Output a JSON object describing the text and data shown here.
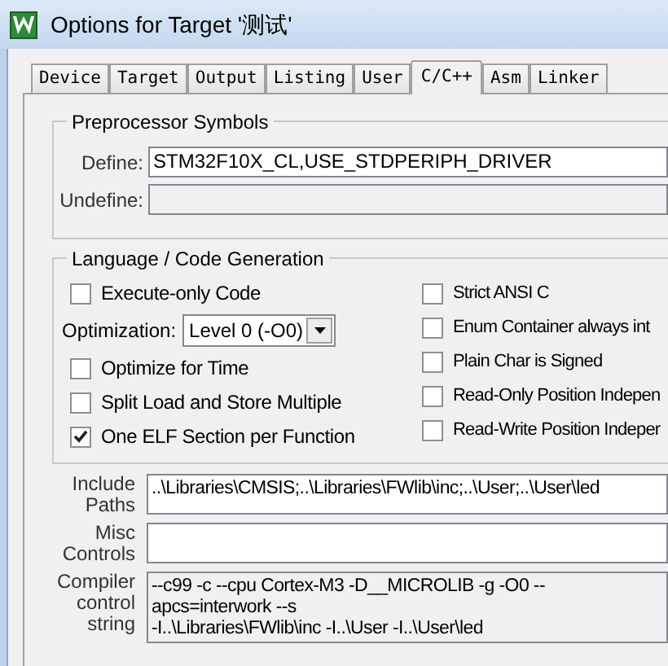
{
  "window": {
    "title": "Options for Target '测试'"
  },
  "tabs": [
    {
      "label": "Device",
      "selected": false
    },
    {
      "label": "Target",
      "selected": false
    },
    {
      "label": "Output",
      "selected": false
    },
    {
      "label": "Listing",
      "selected": false
    },
    {
      "label": "User",
      "selected": false
    },
    {
      "label": "C/C++",
      "selected": true
    },
    {
      "label": "Asm",
      "selected": false
    },
    {
      "label": "Linker",
      "selected": false
    }
  ],
  "preprocessor": {
    "title": "Preprocessor Symbols",
    "fields": [
      {
        "label": "Define:",
        "value": "STM32F10X_CL,USE_STDPERIPH_DRIVER",
        "disabled": false
      },
      {
        "label": "Undefine:",
        "disabled": true
      }
    ]
  },
  "language": {
    "title": "Language / Code Generation",
    "left": [
      {
        "kind": "checkbox",
        "label": "Execute-only Code",
        "checked": false
      },
      {
        "kind": "dropdown",
        "label": "Optimization:",
        "value": "Level 0 (-O0)"
      },
      {
        "kind": "checkbox",
        "label": "Optimize for Time",
        "checked": false
      },
      {
        "kind": "checkbox",
        "label": "Split Load and Store Multiple",
        "checked": false
      },
      {
        "kind": "checkbox",
        "label": "One ELF Section per Function",
        "checked": true
      }
    ],
    "right": [
      {
        "kind": "checkbox",
        "label": "Strict ANSI C",
        "checked": false
      },
      {
        "kind": "checkbox",
        "label": "Enum Container always int",
        "checked": false
      },
      {
        "kind": "checkbox",
        "label": "Plain Char is Signed",
        "checked": false
      },
      {
        "kind": "checkbox",
        "label": "Read-Only Position Indepen",
        "checked": false
      },
      {
        "kind": "checkbox",
        "label": "Read-Write Position Indeper",
        "checked": false
      }
    ]
  },
  "options": [
    {
      "label_lines": [
        "Include",
        "Paths"
      ],
      "lines": [
        "..\\Libraries\\CMSIS;..\\Libraries\\FWlib\\inc;..\\User;..\\User\\led"
      ],
      "disabled": false
    },
    {
      "label_lines": [
        "Misc",
        "Controls"
      ],
      "disabled": false
    },
    {
      "label_lines": [
        "Compiler",
        "control",
        "string"
      ],
      "lines": [
        "--c99 -c --cpu Cortex-M3 -D__MICROLIB -g -O0 --apcs=interwork --s",
        "-I..\\Libraries\\FWlib\\inc -I..\\User -I..\\User\\led"
      ],
      "disabled": true
    }
  ]
}
